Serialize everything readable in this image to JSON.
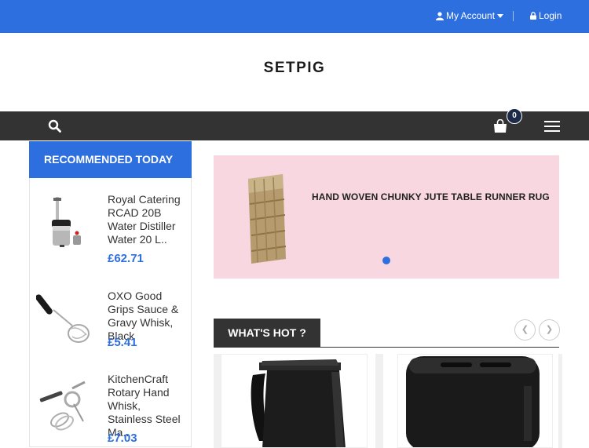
{
  "topbar": {
    "account_label": "My Account",
    "login_label": "Login"
  },
  "brand": {
    "logo_text": "SETPIG"
  },
  "navbar": {
    "cart_count": "0"
  },
  "sidebar": {
    "title": "RECOMMENDED TODAY",
    "products": [
      {
        "name": "Royal Catering RCAD 20B Water Distiller Water 20 L..",
        "price": "£62.71"
      },
      {
        "name": "OXO Good Grips Sauce & Gravy Whisk, Black",
        "price": "£5.41"
      },
      {
        "name": "KitchenCraft Rotary Hand Whisk, Stainless Steel Ma..",
        "price": "£7.03"
      }
    ]
  },
  "banner": {
    "caption": "HAND WOVEN CHUNKY JUTE TABLE RUNNER RUG",
    "slide_count": 1,
    "active_slide": 1
  },
  "hot": {
    "title": "WHAT'S HOT ?"
  },
  "colors": {
    "accent": "#2e6fe0",
    "dark_bar": "#333333",
    "banner_bg": "#f8d7e0"
  }
}
